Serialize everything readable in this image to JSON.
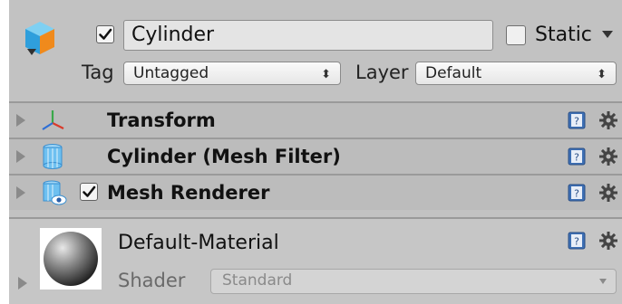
{
  "header": {
    "active_checked": true,
    "object_name": "Cylinder",
    "static_label": "Static",
    "static_checked": false,
    "tag_label": "Tag",
    "tag_value": "Untagged",
    "layer_label": "Layer",
    "layer_value": "Default",
    "dropdown_arrows": "⬍"
  },
  "components": [
    {
      "title": "Transform",
      "icon": "transform-axes-icon"
    },
    {
      "title": "Cylinder (Mesh Filter)",
      "icon": "mesh-filter-icon"
    },
    {
      "title": "Mesh Renderer",
      "icon": "mesh-renderer-icon",
      "enabled": true
    }
  ],
  "material": {
    "name": "Default-Material",
    "shader_label": "Shader",
    "shader_value": "Standard"
  },
  "colors": {
    "panel_bg": "#c2c2c2",
    "component_header_bg": "#bcbcbc",
    "help_blue": "#3d6fb4"
  }
}
